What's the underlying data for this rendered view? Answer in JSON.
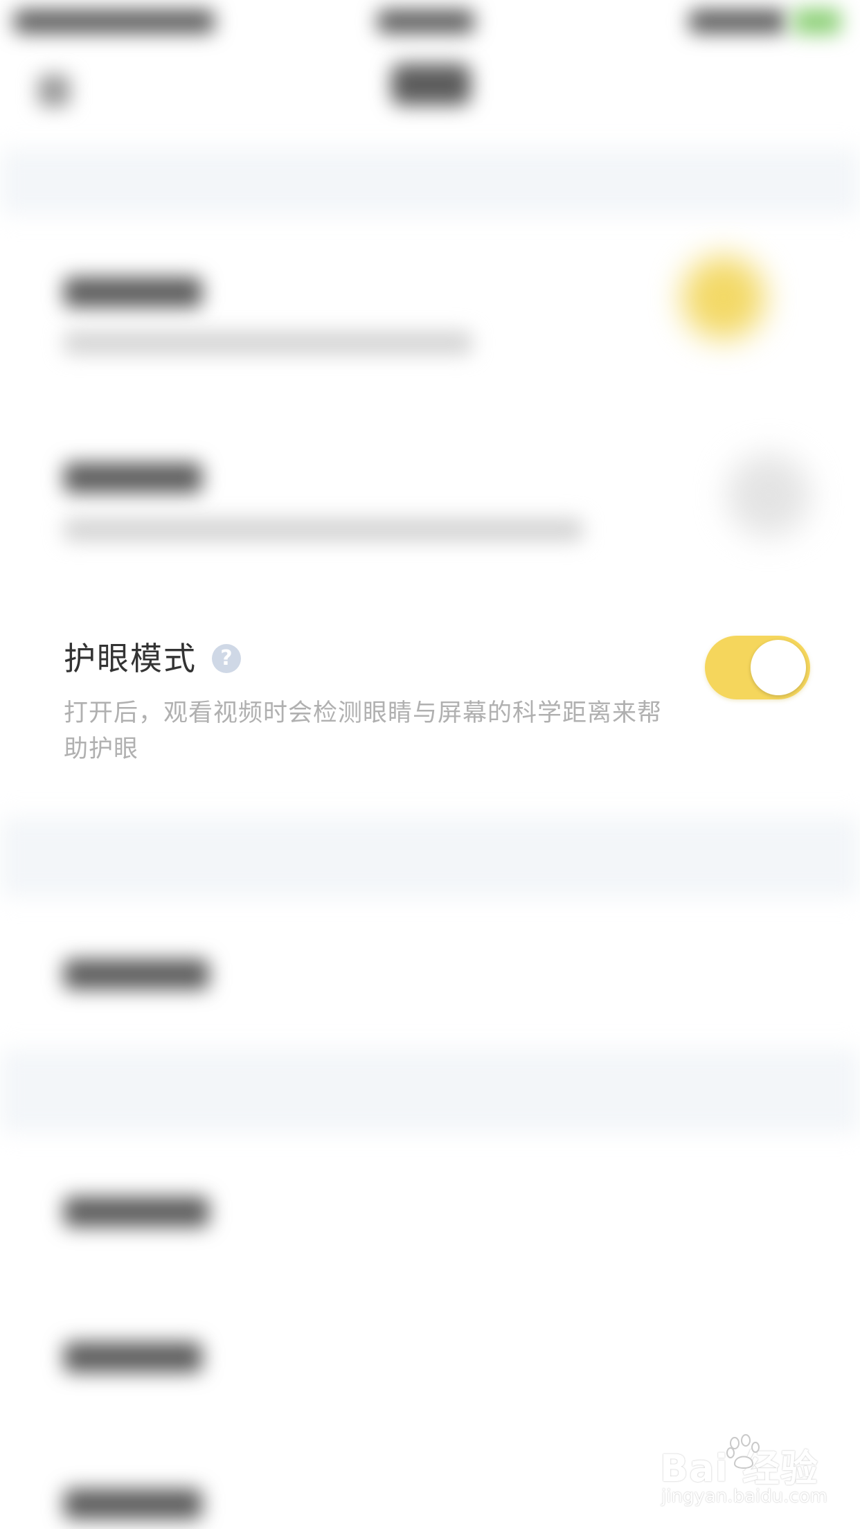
{
  "eye_protection": {
    "title": "护眼模式",
    "help_glyph": "?",
    "description": "打开后，观看视频时会检测眼睛与屏幕的科学距离来帮助护眼",
    "toggle_on": true,
    "toggle_color": "#f5d65c"
  },
  "watermark": {
    "logo_text": "Bai  经验",
    "url": "jingyan.baidu.com"
  }
}
